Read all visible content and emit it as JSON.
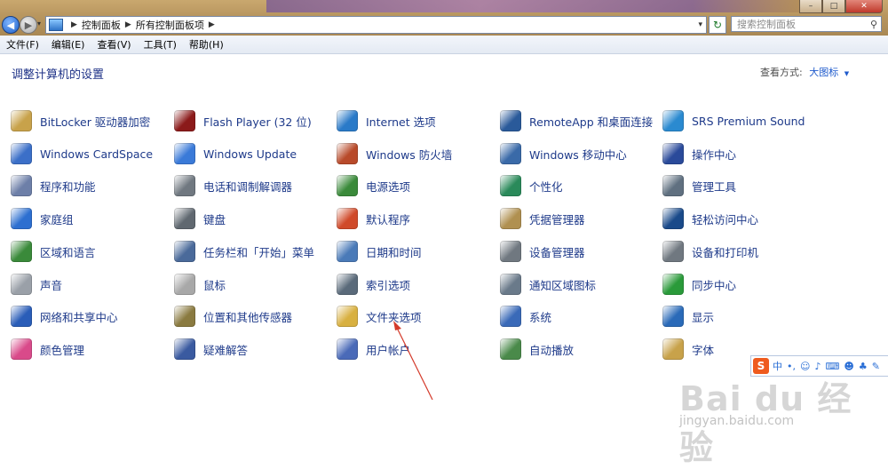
{
  "address_bar": {
    "crumbs": [
      "控制面板",
      "所有控制面板项"
    ]
  },
  "search": {
    "placeholder": "搜索控制面板"
  },
  "menu": [
    "文件(F)",
    "编辑(E)",
    "查看(V)",
    "工具(T)",
    "帮助(H)"
  ],
  "page": {
    "title": "调整计算机的设置",
    "view_by_label": "查看方式:",
    "view_by_value": "大图标"
  },
  "items": [
    [
      "BitLocker 驱动器加密",
      "Windows CardSpace",
      "程序和功能",
      "家庭组",
      "区域和语言",
      "声音",
      "网络和共享中心",
      "颜色管理"
    ],
    [
      "Flash Player (32 位)",
      "Windows Update",
      "电话和调制解调器",
      "键盘",
      "任务栏和「开始」菜单",
      "鼠标",
      "位置和其他传感器",
      "疑难解答"
    ],
    [
      "Internet 选项",
      "Windows 防火墙",
      "电源选项",
      "默认程序",
      "日期和时间",
      "索引选项",
      "文件夹选项",
      "用户帐户"
    ],
    [
      "RemoteApp 和桌面连接",
      "Windows 移动中心",
      "个性化",
      "凭据管理器",
      "设备管理器",
      "通知区域图标",
      "系统",
      "自动播放"
    ],
    [
      "SRS Premium Sound",
      "操作中心",
      "管理工具",
      "轻松访问中心",
      "设备和打印机",
      "同步中心",
      "显示",
      "字体"
    ]
  ],
  "icon_colors": [
    [
      "#c8a24a",
      "#3b6fc8",
      "#6d7fa8",
      "#2d6fd0",
      "#3a8a3a",
      "#9aa0a8",
      "#2a5db8",
      "#d94a8a"
    ],
    [
      "#8b1a1a",
      "#3a7ad8",
      "#707880",
      "#606870",
      "#4a6a9a",
      "#a8a8a8",
      "#8a7a40",
      "#3a5aa0"
    ],
    [
      "#2a7ac8",
      "#b84a2a",
      "#3a8a3a",
      "#d04a2a",
      "#4a7ab8",
      "#5a6a7a",
      "#d8b040",
      "#4a6ab8"
    ],
    [
      "#2a5a9a",
      "#3a6aa8",
      "#2a8a5a",
      "#b09050",
      "#707880",
      "#6a7a8a",
      "#3a6ab8",
      "#4a8a4a"
    ],
    [
      "#2a8ad0",
      "#2a4a9a",
      "#607080",
      "#1a4a8a",
      "#707880",
      "#2a9a3a",
      "#2a6ab8",
      "#c8a24a"
    ]
  ],
  "ime_toolbar": {
    "logo": "S",
    "lang": "中"
  },
  "watermark": {
    "main": "Bai du 经验",
    "url": "jingyan.baidu.com"
  }
}
